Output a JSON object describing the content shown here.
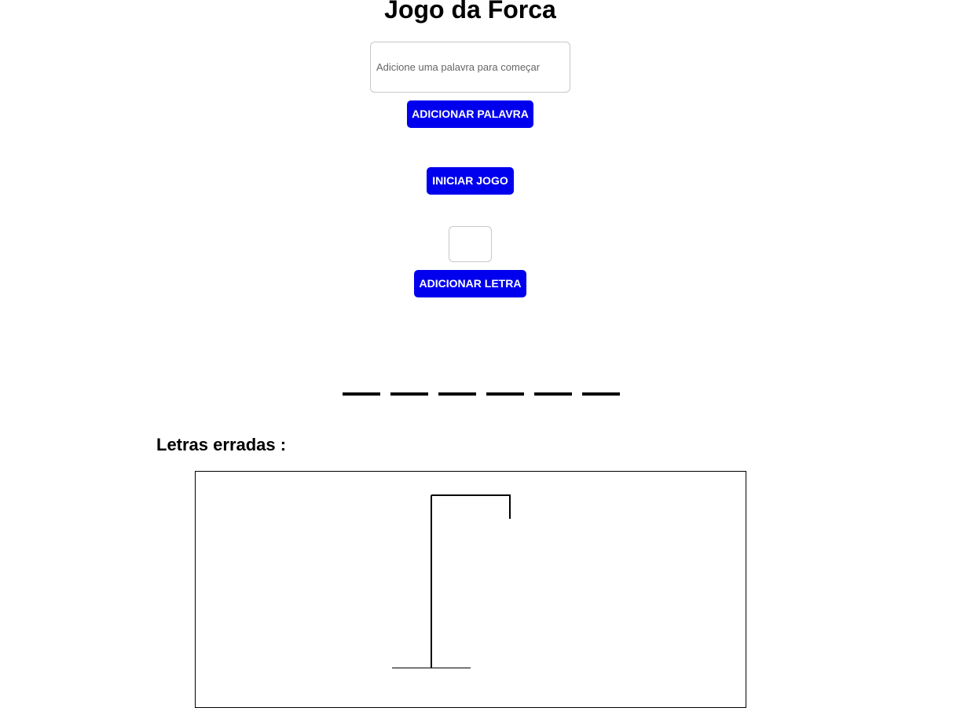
{
  "title": "Jogo da Forca",
  "word_input": {
    "value": "",
    "placeholder": "Adicione uma palavra para começar"
  },
  "buttons": {
    "add_word": "ADICIONAR PALAVRA",
    "start_game": "INICIAR JOGO",
    "add_letter": "ADICIONAR LETRA"
  },
  "letter_input": {
    "value": ""
  },
  "word_slots": {
    "count": 6,
    "revealed": [
      "",
      "",
      "",
      "",
      "",
      ""
    ]
  },
  "wrong_letters": {
    "label": "Letras erradas :",
    "letters": ""
  },
  "colors": {
    "button_bg": "#0000ee",
    "button_text": "#ffffff"
  }
}
